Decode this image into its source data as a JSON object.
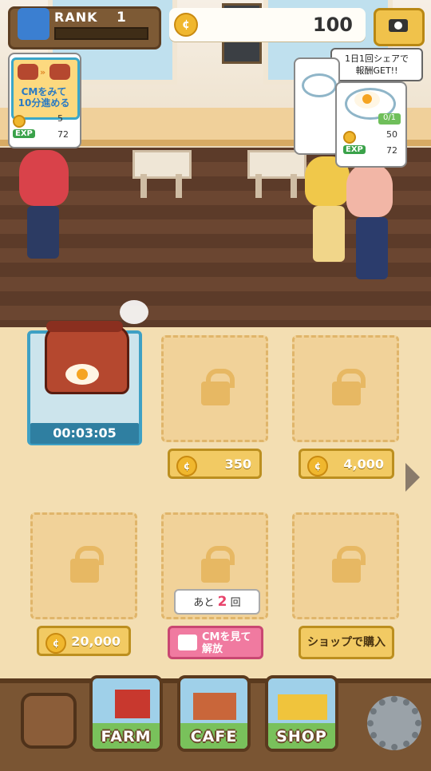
{
  "header": {
    "rank_label": "RANK",
    "rank_value": "1",
    "coin_amount": "100",
    "share_bubble": "1日1回シェアで\n報酬GET!!"
  },
  "orders": [
    {
      "ad_text": "CMをみて\n10分進める",
      "exp_label": "EXP",
      "exp_value": "72",
      "price": "5"
    },
    {
      "exp_label": "EXP",
      "price": "50",
      "exp_value": "72",
      "progress": "0/1"
    }
  ],
  "slots": {
    "timer": "00:03:05",
    "prices": [
      "350",
      "4,000",
      "20,000"
    ],
    "remain_prefix": "あと",
    "remain_count": "2",
    "remain_suffix": "回",
    "cm_unlock": "CMを見て\n解放",
    "shop_buy": "ショップで購入"
  },
  "nav": {
    "farm": "FARM",
    "cafe": "CAFE",
    "shop": "SHOP"
  },
  "colors": {
    "accent_blue": "#3ea0c4",
    "coin_gold": "#f0b72e",
    "pink": "#f07aa0"
  }
}
